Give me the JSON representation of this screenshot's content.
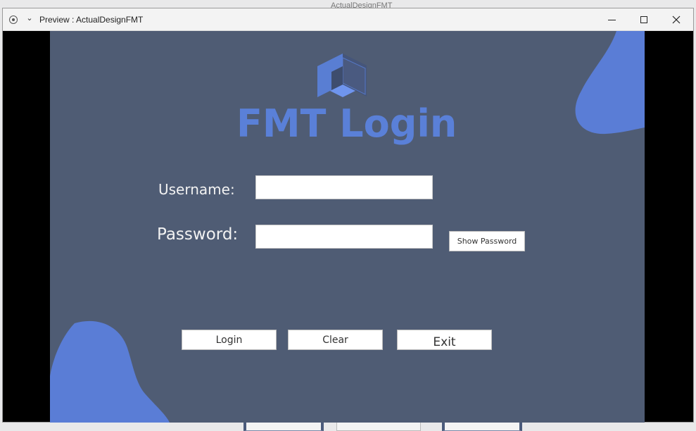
{
  "window": {
    "title": "Preview : ActualDesignFMT",
    "background_title_peek": "ActualDesignFMT"
  },
  "app": {
    "brand_title": "FMT Login",
    "username_label": "Username:",
    "password_label": "Password:",
    "username_value": "",
    "password_value": "",
    "show_password_label": "Show Password",
    "login_label": "Login",
    "clear_label": "Clear",
    "exit_label": "Exit"
  },
  "colors": {
    "canvas_bg": "#4f5c74",
    "accent_blue": "#5a80d8",
    "label_text": "#f2f2f2"
  },
  "icons": {
    "window_icon": "record-icon",
    "chevron": "chevron-down-icon",
    "logo": "isometric-cube-logo-icon",
    "minimize": "minimize-icon",
    "maximize": "maximize-icon",
    "close": "close-icon"
  }
}
